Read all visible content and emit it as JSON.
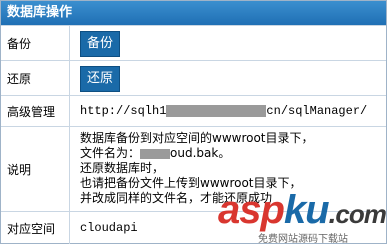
{
  "header": {
    "title": "数据库操作"
  },
  "rows": {
    "backup": {
      "label": "备份",
      "button": "备份"
    },
    "restore": {
      "label": "还原",
      "button": "还原"
    },
    "admin": {
      "label": "高级管理",
      "url_prefix": "http://sqlh1",
      "url_suffix": "cn/sqlManager/"
    },
    "desc": {
      "label": "说明",
      "lines": [
        "数据库备份到对应空间的wwwroot目录下，",
        "文件名为：",
        "oud.bak。",
        "还原数据库时，",
        "也请把备份文件上传到wwwroot目录下，",
        "并改成同样的文件名，才能还原成功"
      ]
    },
    "space": {
      "label": "对应空间",
      "value": "cloudapi"
    }
  },
  "watermark": {
    "a": "asp",
    "k": "ku",
    "dot": ".",
    "cn": "com",
    "sub": "免费网站源码下载站"
  }
}
